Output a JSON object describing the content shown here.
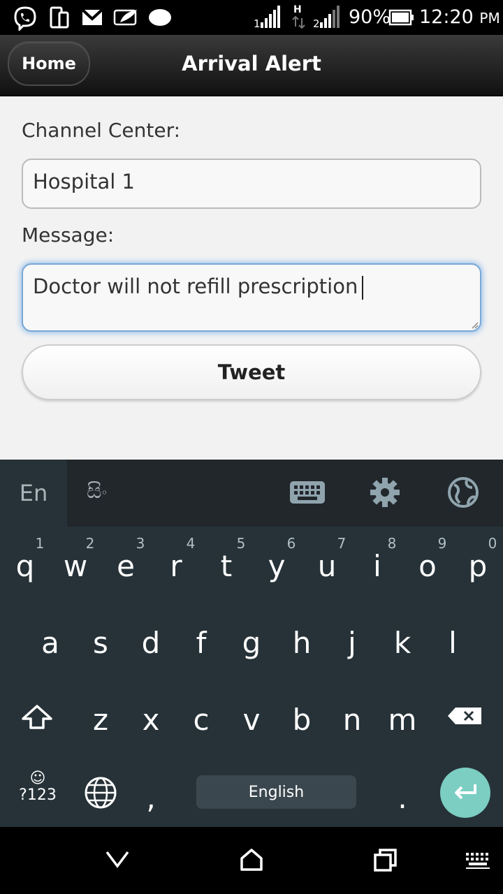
{
  "status_bar": {
    "battery": "90%",
    "time": "12:20",
    "ampm": "PM",
    "network": "H",
    "icons": [
      "viber-icon",
      "phone-tablet-icon",
      "gmail-icon",
      "feather-icon",
      "cloud-icon"
    ]
  },
  "header": {
    "home_label": "Home",
    "title": "Arrival Alert"
  },
  "form": {
    "channel_label": "Channel Center:",
    "channel_value": "Hospital 1",
    "message_label": "Message:",
    "message_value": "Doctor will not refill prescription",
    "tweet_label": "Tweet"
  },
  "keyboard": {
    "lang_en": "En",
    "lang_alt": "සිං",
    "row1": [
      "q",
      "w",
      "e",
      "r",
      "t",
      "y",
      "u",
      "i",
      "o",
      "p"
    ],
    "row1_hints": [
      "1",
      "2",
      "3",
      "4",
      "5",
      "6",
      "7",
      "8",
      "9",
      "0"
    ],
    "row2": [
      "a",
      "s",
      "d",
      "f",
      "g",
      "h",
      "j",
      "k",
      "l"
    ],
    "row3": [
      "z",
      "x",
      "c",
      "v",
      "b",
      "n",
      "m"
    ],
    "symbols_label": "?123",
    "comma": ",",
    "period": ".",
    "space_label": "English"
  },
  "colors": {
    "keyboard_bg": "#263238",
    "enter_key": "#7ccdc2",
    "focus_glow": "#9cc3ec"
  }
}
